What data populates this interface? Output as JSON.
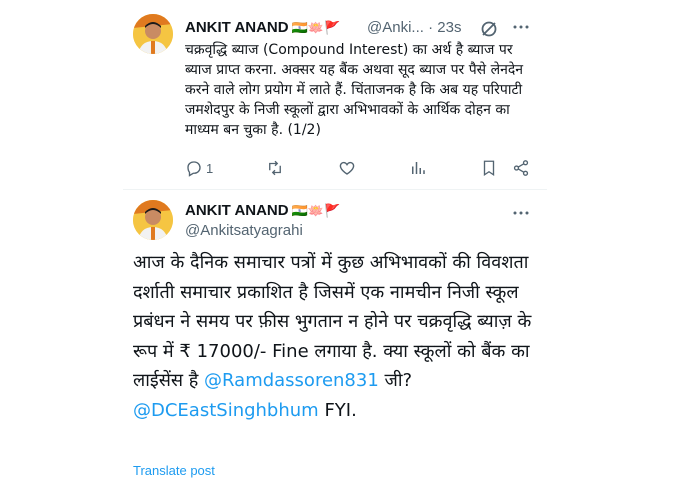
{
  "tweet1": {
    "author": "ANKIT ANAND",
    "badges": "🇮🇳🪷🚩",
    "handle": "@Anki...",
    "separator": "·",
    "time": "23s",
    "text": "चक्रवृद्धि ब्याज (Compound Interest) का अर्थ है ब्याज पर ब्याज प्राप्त करना. अक्सर यह बैंक अथवा सूद ब्याज पर पैसे लेनदेन करने वाले लोग प्रयोग में लाते हैं. चिंताजनक है कि अब यह परिपाटी जमशेदपुर के निजी स्कूलों द्वारा अभिभावकों के आर्थिक दोहन का माध्यम बन चुका है. (1/2)",
    "reply_count": "1"
  },
  "tweet2": {
    "author": "ANKIT ANAND",
    "badges": "🇮🇳🪷🚩",
    "handle": "@Ankitsatyagrahi",
    "text_part1": "आज के दैनिक समाचार पत्रों में कुछ अभिभावकों की विवशता दर्शाती समाचार प्रकाशित है जिसमें एक नामचीन निजी स्कूल प्रबंधन ने समय पर फ़ीस भुगतान न होने पर चक्रवृद्धि ब्याज़ के रूप में ₹ 17000/- Fine लगाया है. क्या स्कूलों को बैंक का लाईसेंस है ",
    "mention1": "@Ramdassoren831",
    "text_part2": " जी?",
    "mention2": "@DCEastSinghbhum",
    "text_part3": " FYI.",
    "translate_label": "Translate post"
  },
  "icons": {
    "more": "more-horizontal-icon",
    "reply": "reply-icon",
    "retweet": "retweet-icon",
    "like": "heart-icon",
    "views": "views-chart-icon",
    "bookmark": "bookmark-icon",
    "share": "share-icon",
    "grok": "grok-icon"
  },
  "colors": {
    "text": "#0f1419",
    "secondary": "#536471",
    "link": "#1d9bf0",
    "divider": "#eff3f4"
  }
}
